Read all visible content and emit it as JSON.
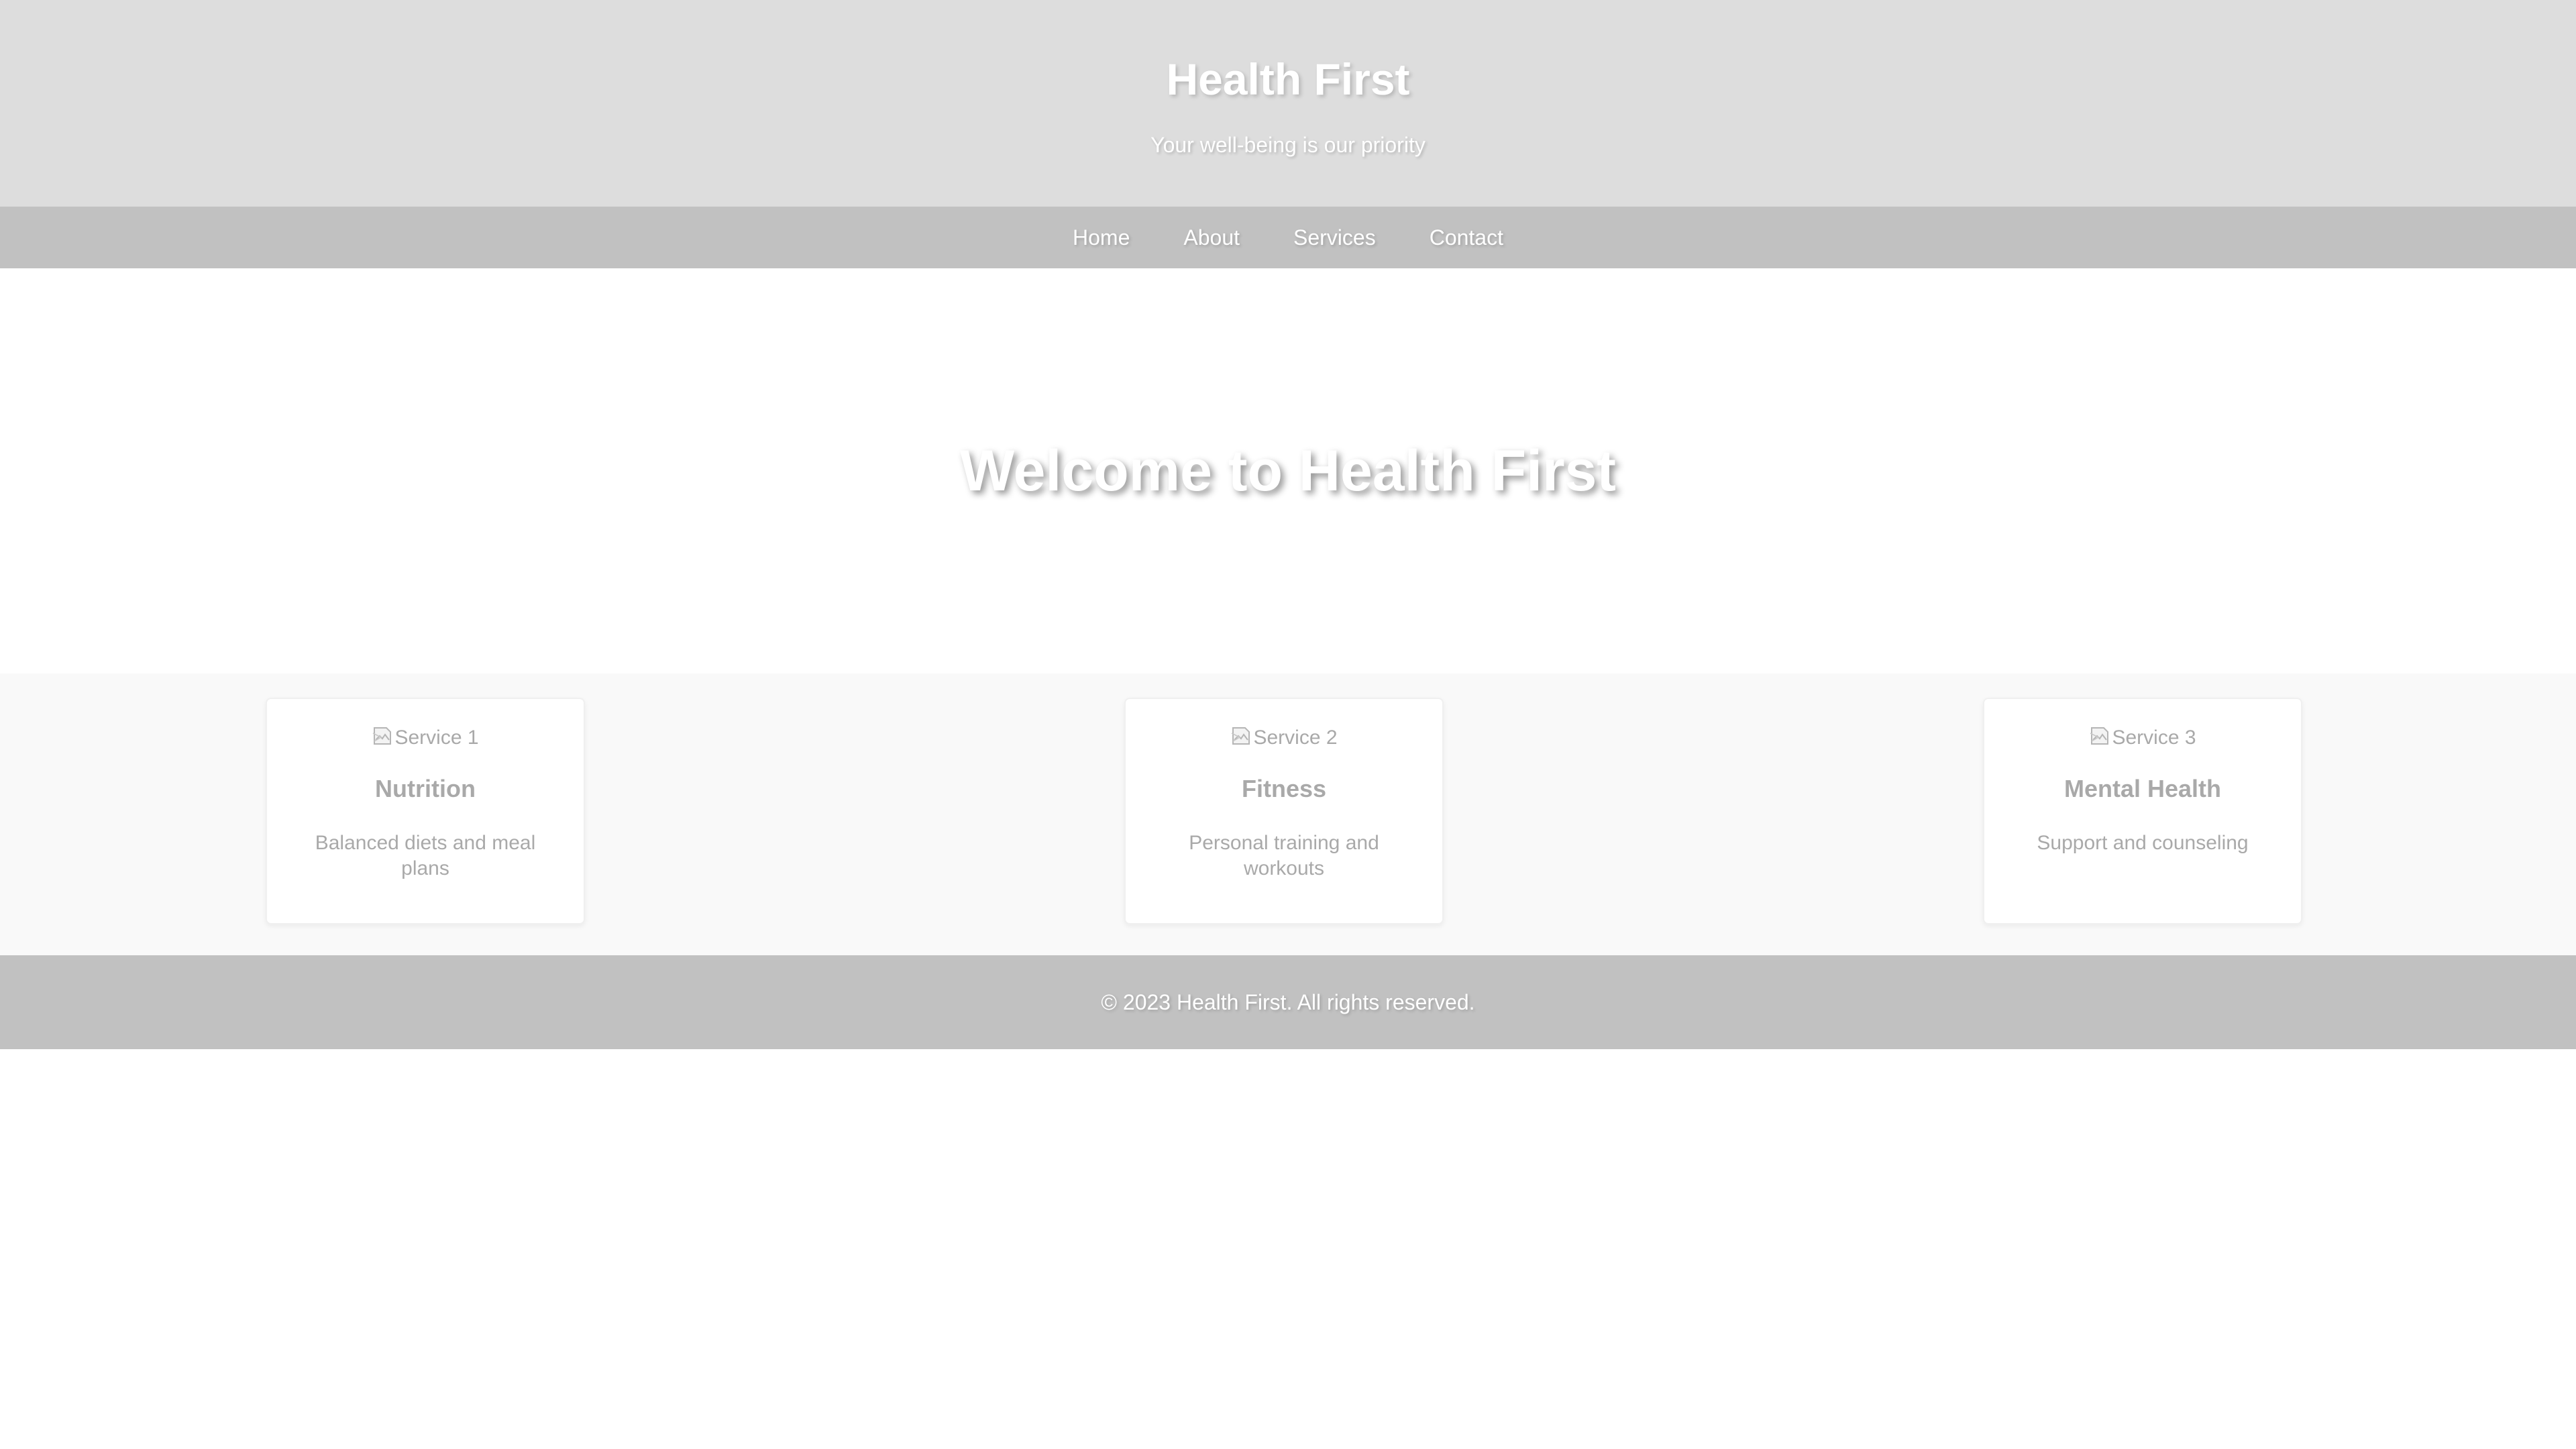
{
  "header": {
    "title": "Health First",
    "tagline": "Your well-being is our priority"
  },
  "nav": {
    "items": [
      {
        "label": "Home"
      },
      {
        "label": "About"
      },
      {
        "label": "Services"
      },
      {
        "label": "Contact"
      }
    ]
  },
  "hero": {
    "heading": "Welcome to Health First"
  },
  "services": {
    "cards": [
      {
        "image_alt": "Service 1",
        "title": "Nutrition",
        "description": "Balanced diets and meal plans"
      },
      {
        "image_alt": "Service 2",
        "title": "Fitness",
        "description": "Personal training and workouts"
      },
      {
        "image_alt": "Service 3",
        "title": "Mental Health",
        "description": "Support and counseling"
      }
    ]
  },
  "footer": {
    "text": "© 2023 Health First. All rights reserved."
  },
  "colors": {
    "header_bg": "#dddddd",
    "nav_bg": "#c1c1c1",
    "services_bg": "#f9f9f9",
    "footer_bg": "#c1c1c1",
    "card_text": "#a9a9a9",
    "header_text": "#ffffff"
  },
  "icons": {
    "card_image": "broken-image-icon"
  }
}
